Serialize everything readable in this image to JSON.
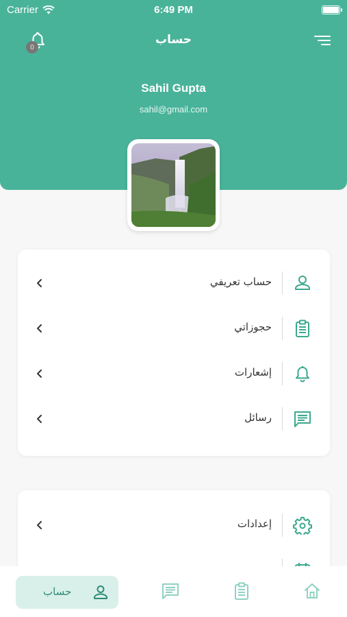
{
  "status_bar": {
    "carrier": "Carrier",
    "time": "6:49 PM"
  },
  "header": {
    "title": "حساب",
    "notification_count": "0"
  },
  "profile": {
    "name": "Sahil Gupta",
    "email": "sahil@gmail.com"
  },
  "menu_card": {
    "items": [
      {
        "label": "حساب تعريفي",
        "icon": "user-icon"
      },
      {
        "label": "حجوزاتي",
        "icon": "clipboard-icon"
      },
      {
        "label": "إشعارات",
        "icon": "bell-icon"
      },
      {
        "label": "رسائل",
        "icon": "message-icon"
      }
    ]
  },
  "settings_card": {
    "items": [
      {
        "label": "إعدادات",
        "icon": "gear-icon"
      },
      {
        "label": "...",
        "icon": "calendar-icon"
      }
    ]
  },
  "bottom_nav": {
    "active_label": "حساب",
    "tabs": [
      "user-icon",
      "message-icon",
      "clipboard-icon",
      "home-icon"
    ]
  },
  "colors": {
    "accent": "#49b39a",
    "icon": "#3aa88e",
    "active_tab_bg": "#d9f0ea"
  }
}
